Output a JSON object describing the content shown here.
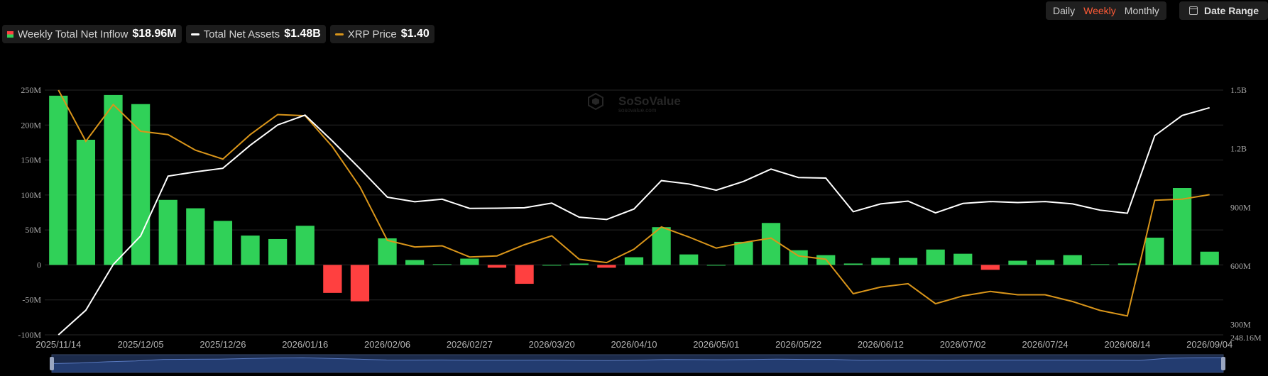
{
  "legend": {
    "inflow_label": "Weekly Total Net Inflow",
    "inflow_value": "$18.96M",
    "assets_label": "Total Net Assets",
    "assets_value": "$1.48B",
    "price_label": "XRP Price",
    "price_value": "$1.40"
  },
  "period": {
    "daily": "Daily",
    "weekly": "Weekly",
    "monthly": "Monthly",
    "selected": "Weekly"
  },
  "date_range": {
    "label": "Date Range"
  },
  "watermark": {
    "brand": "SoSoValue",
    "site": "sosovalue.com"
  },
  "colors": {
    "positive": "#30d158",
    "negative": "#ff4040",
    "assets_line": "#ffffff",
    "price_line": "#d9951a",
    "grid": "#262626",
    "accent": "#ff5a36"
  },
  "chart_data": {
    "type": "bar",
    "grid": true,
    "legend_position": "top-left",
    "ylim_left": [
      -100,
      250
    ],
    "yticks_left": [
      "-100M",
      "-50M",
      "0",
      "50M",
      "100M",
      "150M",
      "200M",
      "250M"
    ],
    "yticks_right": [
      "300M",
      "600M",
      "900M",
      "1.2B",
      "1.5B"
    ],
    "y_right_min_label": "248.16M",
    "ylim_right": [
      248.16,
      1500
    ],
    "price_scale_approx": [
      1.4,
      3.6
    ],
    "x_tick_labels": [
      "2025/11/14",
      "2025/12/05",
      "2025/12/26",
      "2026/01/16",
      "2026/02/06",
      "2026/02/27",
      "2026/03/20",
      "2026/04/10",
      "2026/05/01",
      "2026/05/22",
      "2026/06/12",
      "2026/07/02",
      "2026/07/24",
      "2026/08/14",
      "2026/09/04"
    ],
    "x": [
      "2025/11/14",
      "2025/11/21",
      "2025/11/28",
      "2025/12/05",
      "2025/12/12",
      "2025/12/19",
      "2025/12/26",
      "2026/01/02",
      "2026/01/09",
      "2026/01/16",
      "2026/01/23",
      "2026/01/30",
      "2026/02/06",
      "2026/02/13",
      "2026/02/20",
      "2026/02/27",
      "2026/03/06",
      "2026/03/13",
      "2026/03/20",
      "2026/03/27",
      "2026/04/03",
      "2026/04/10",
      "2026/04/17",
      "2026/04/24",
      "2026/05/01",
      "2026/05/08",
      "2026/05/15",
      "2026/05/22",
      "2026/05/29",
      "2026/06/05",
      "2026/06/12",
      "2026/06/19",
      "2026/06/26",
      "2026/07/02",
      "2026/07/10",
      "2026/07/17",
      "2026/07/24",
      "2026/07/31",
      "2026/08/07",
      "2026/08/14",
      "2026/08/21",
      "2026/08/28",
      "2026/09/04"
    ],
    "series": [
      {
        "name": "Weekly Total Net Inflow",
        "type": "bar",
        "unit": "M",
        "values": [
          242,
          179,
          243,
          230,
          93,
          81,
          63,
          42,
          37,
          56,
          -40,
          -52,
          38,
          7,
          1,
          9,
          -4,
          -27,
          0,
          2,
          -4,
          11,
          54,
          15,
          0,
          33,
          60,
          21,
          14,
          2,
          10,
          10,
          22,
          16,
          -7,
          6,
          7,
          14,
          1,
          2,
          39,
          110,
          18.96
        ]
      },
      {
        "name": "Total Net Assets",
        "type": "line",
        "unit": "M",
        "values": [
          248,
          374,
          608,
          754,
          1060,
          1082,
          1100,
          1218,
          1322,
          1372,
          1239,
          1098,
          952,
          929,
          942,
          895,
          896,
          898,
          922,
          850,
          838,
          892,
          1037,
          1020,
          988,
          1033,
          1096,
          1053,
          1050,
          878,
          918,
          932,
          872,
          920,
          930,
          925,
          930,
          918,
          886,
          870,
          1267,
          1370,
          1410
        ]
      },
      {
        "name": "XRP Price",
        "type": "line",
        "unit": "$",
        "values": [
          3.6,
          3.14,
          3.47,
          3.23,
          3.2,
          3.06,
          2.98,
          3.2,
          3.38,
          3.37,
          3.09,
          2.73,
          2.25,
          2.19,
          2.2,
          2.1,
          2.11,
          2.21,
          2.29,
          2.08,
          2.05,
          2.17,
          2.37,
          2.28,
          2.18,
          2.23,
          2.27,
          2.11,
          2.08,
          1.77,
          1.83,
          1.86,
          1.68,
          1.75,
          1.79,
          1.76,
          1.76,
          1.7,
          1.62,
          1.57,
          2.61,
          2.62,
          2.66
        ]
      }
    ]
  }
}
